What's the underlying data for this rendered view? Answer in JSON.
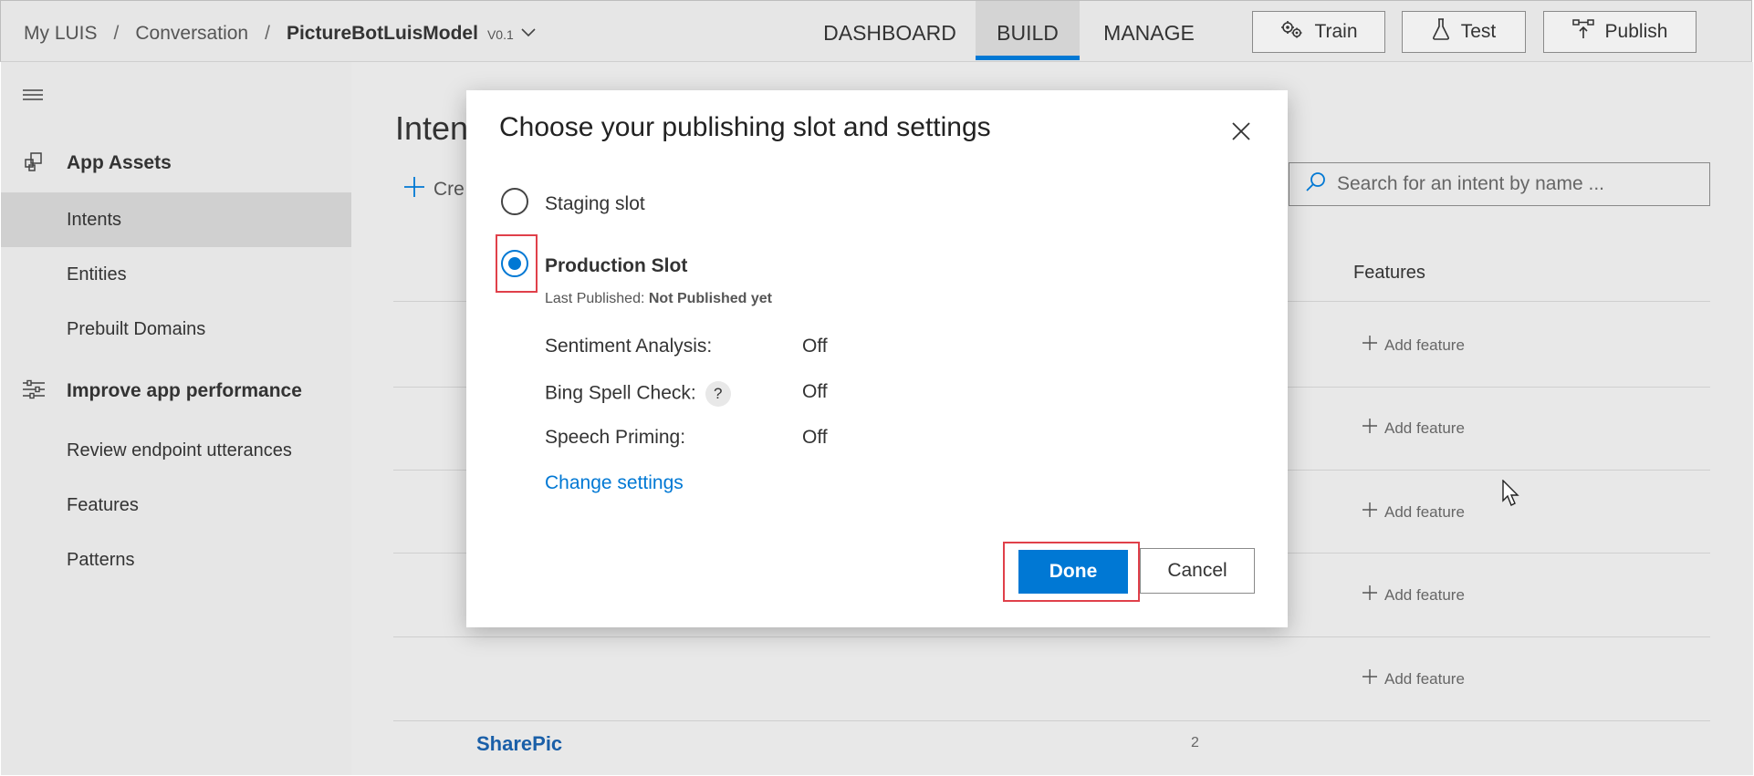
{
  "header": {
    "breadcrumb": [
      "My LUIS",
      "Conversation",
      "PictureBotLuisModel"
    ],
    "version": "V0.1",
    "tabs": [
      "DASHBOARD",
      "BUILD",
      "MANAGE"
    ],
    "active_tab": "BUILD",
    "buttons": {
      "train": "Train",
      "test": "Test",
      "publish": "Publish"
    }
  },
  "sidebar": {
    "section1": "App Assets",
    "items1": [
      "Intents",
      "Entities",
      "Prebuilt Domains"
    ],
    "section2": "Improve app performance",
    "items2": [
      "Review endpoint utterances",
      "Features",
      "Patterns"
    ]
  },
  "main": {
    "title": "Inten",
    "create_label": "Cre",
    "search_placeholder": "Search for an intent by name ...",
    "features_header": "Features",
    "add_feature": "Add feature",
    "last_row": {
      "intent": "SharePic",
      "count": "2"
    }
  },
  "dialog": {
    "title": "Choose your publishing slot and settings",
    "staging_label": "Staging slot",
    "production_label": "Production Slot",
    "last_published_label": "Last Published:",
    "last_published_value": "Not Published yet",
    "settings": [
      {
        "name": "Sentiment Analysis:",
        "value": "Off"
      },
      {
        "name": "Bing Spell Check:",
        "value": "Off",
        "help": "?"
      },
      {
        "name": "Speech Priming:",
        "value": "Off"
      }
    ],
    "change_settings": "Change settings",
    "done": "Done",
    "cancel": "Cancel"
  },
  "colors": {
    "accent": "#0078d4",
    "highlight": "#e0404a"
  }
}
